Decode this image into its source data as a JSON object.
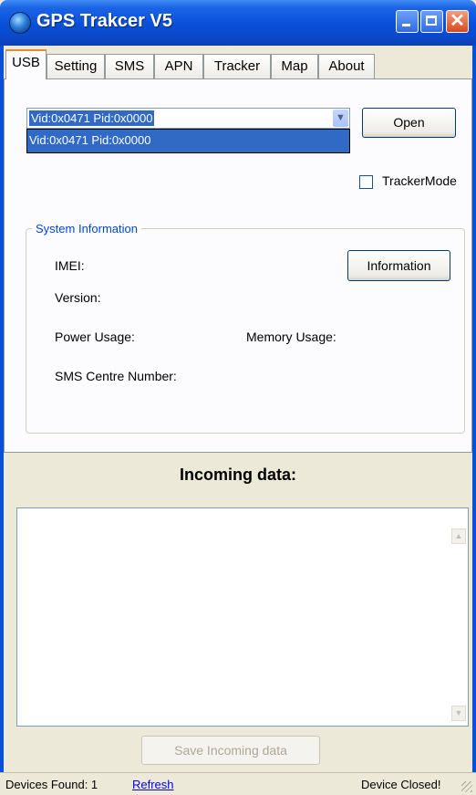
{
  "window": {
    "title": "GPS Trakcer V5",
    "icon": "globe-icon"
  },
  "tabs": [
    {
      "label": "USB",
      "active": true
    },
    {
      "label": "Setting",
      "active": false
    },
    {
      "label": "SMS",
      "active": false
    },
    {
      "label": "APN",
      "active": false
    },
    {
      "label": "Tracker",
      "active": false
    },
    {
      "label": "Map",
      "active": false
    },
    {
      "label": "About",
      "active": false
    }
  ],
  "usb": {
    "device_select": {
      "value": "Vid:0x0471 Pid:0x0000",
      "options": [
        "Vid:0x0471 Pid:0x0000"
      ]
    },
    "open_label": "Open",
    "tracker_mode_label": "TrackerMode",
    "tracker_mode_checked": false
  },
  "system_info": {
    "title": "System Information",
    "imei_label": "IMEI:",
    "version_label": "Version:",
    "power_label": "Power Usage:",
    "memory_label": "Memory Usage:",
    "sms_centre_label": "SMS Centre Number:",
    "information_label": "Information"
  },
  "incoming": {
    "title": "Incoming data:",
    "content": "",
    "save_label": "Save Incoming data"
  },
  "status": {
    "devices_found": "Devices Found:  1",
    "refresh_label": "Refresh",
    "state": "Device Closed!"
  },
  "colors": {
    "title_bar": "#0a4fd8",
    "selection": "#316ac5",
    "group_title": "#0046d5",
    "link": "#0000ff"
  }
}
